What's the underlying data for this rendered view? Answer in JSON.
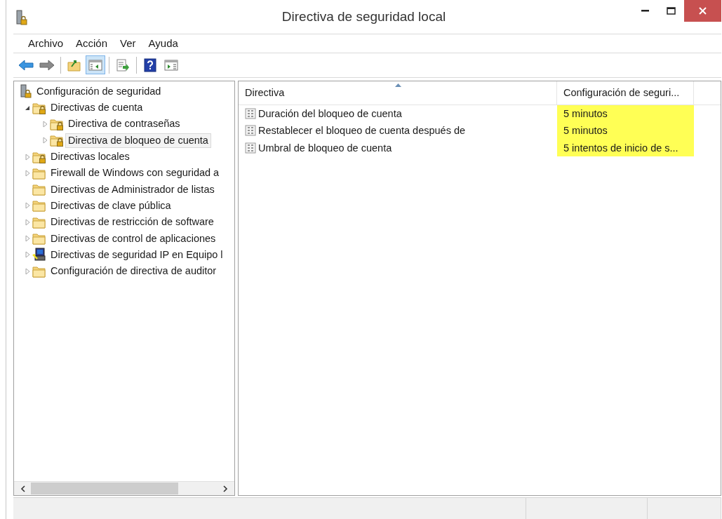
{
  "window": {
    "title": "Directiva de seguridad local"
  },
  "menu": [
    "Archivo",
    "Acción",
    "Ver",
    "Ayuda"
  ],
  "toolbar": [
    {
      "pressed": false
    },
    {
      "pressed": false
    },
    {
      "pressed": false
    },
    {
      "pressed": true
    },
    {
      "pressed": false
    },
    {
      "pressed": false
    },
    {
      "pressed": false
    }
  ],
  "tree": [
    {
      "label": "Configuración de seguridad",
      "kind": "root",
      "selected": false,
      "children": [
        {
          "label": "Directivas de cuenta",
          "kind": "locked-folder",
          "expanded": true,
          "selected": false,
          "children": [
            {
              "label": "Directiva de contraseñas",
              "kind": "locked-folder",
              "expanded": false,
              "selected": false
            },
            {
              "label": "Directiva de bloqueo de cuenta",
              "kind": "locked-folder",
              "expanded": false,
              "selected": true
            }
          ]
        },
        {
          "label": "Directivas locales",
          "kind": "locked-folder",
          "expanded": false,
          "selected": false
        },
        {
          "label": "Firewall de Windows con seguridad a",
          "kind": "folder",
          "expanded": false,
          "selected": false
        },
        {
          "label": "Directivas de Administrador de listas",
          "kind": "folder",
          "selected": false
        },
        {
          "label": "Directivas de clave pública",
          "kind": "folder",
          "expanded": false,
          "selected": false
        },
        {
          "label": "Directivas de restricción de software",
          "kind": "folder",
          "expanded": false,
          "selected": false
        },
        {
          "label": "Directivas de control de aplicaciones",
          "kind": "folder",
          "expanded": false,
          "selected": false
        },
        {
          "label": "Directivas de seguridad IP en Equipo l",
          "kind": "computer",
          "expanded": false,
          "selected": false
        },
        {
          "label": "Configuración de directiva de auditor",
          "kind": "folder",
          "expanded": false,
          "selected": false
        }
      ]
    }
  ],
  "list": {
    "columns": [
      "Directiva",
      "Configuración de seguri..."
    ],
    "rows": [
      {
        "name": "Duración del bloqueo de cuenta",
        "setting": "5 minutos",
        "highlighted": true
      },
      {
        "name": "Restablecer el bloqueo de cuenta después de",
        "setting": "5 minutos",
        "highlighted": true
      },
      {
        "name": "Umbral de bloqueo de cuenta",
        "setting": "5 intentos de inicio de s...",
        "highlighted": true
      }
    ]
  }
}
